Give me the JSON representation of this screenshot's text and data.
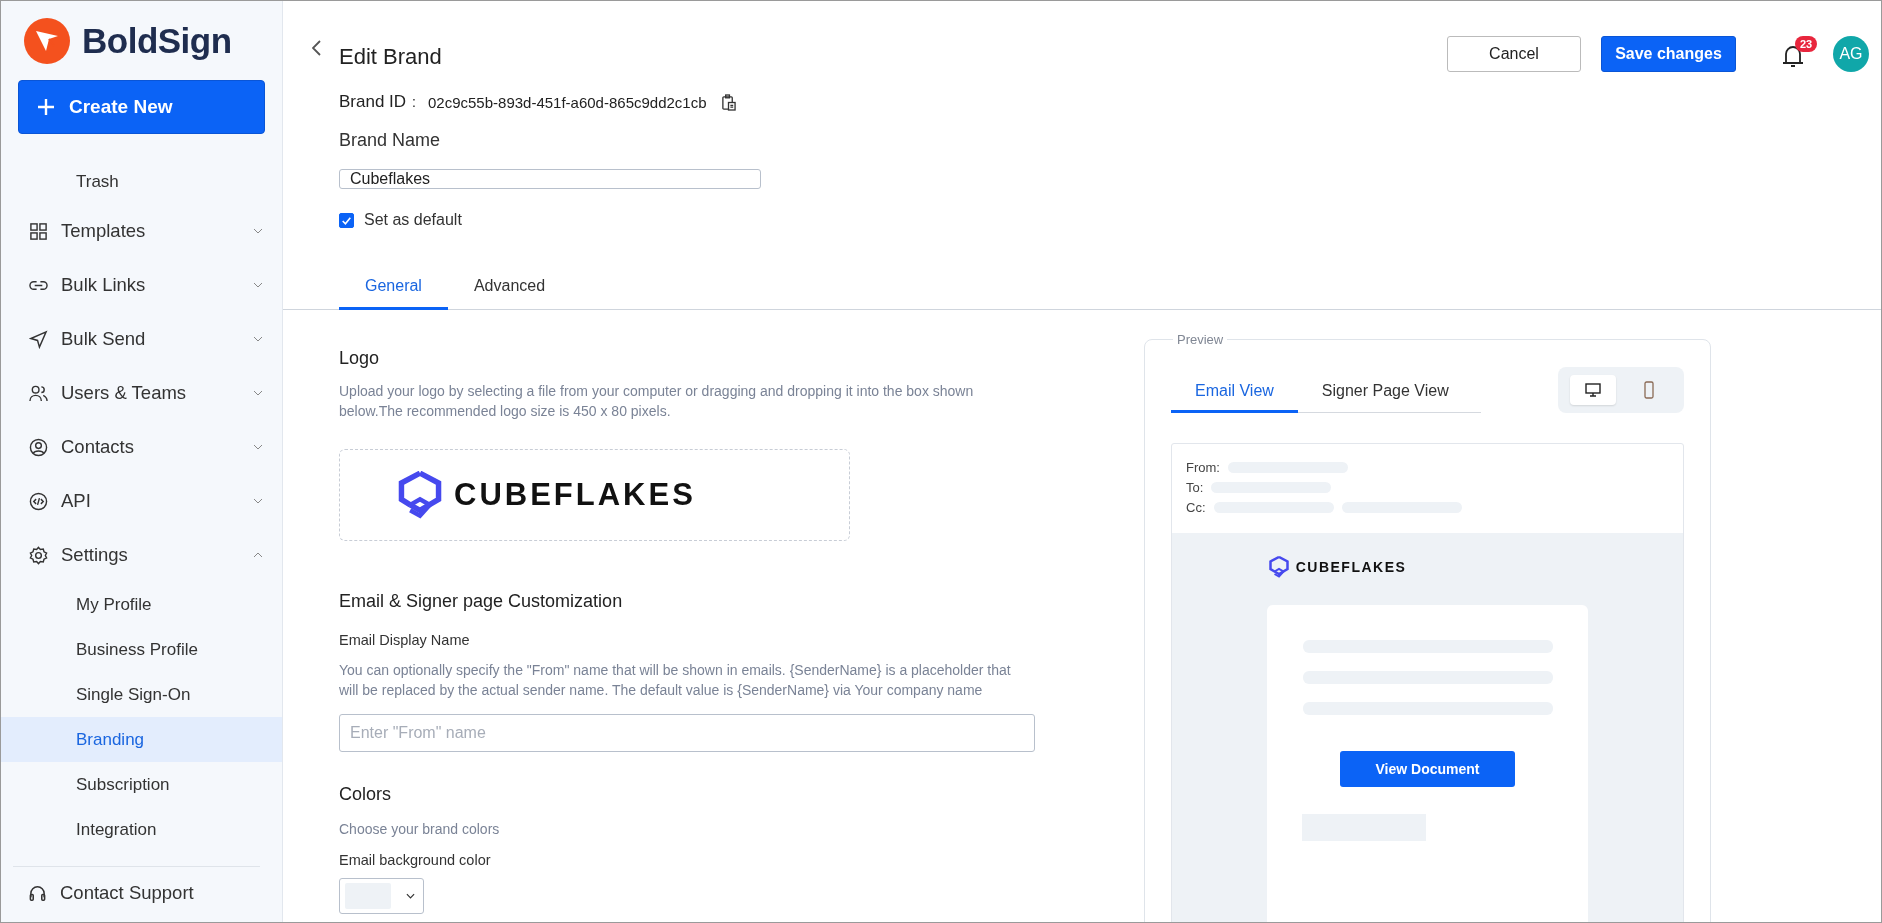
{
  "sidebar": {
    "brand": "BoldSign",
    "create_button": "Create New",
    "scrolled_items": [
      {
        "label": "Trash",
        "selected": false
      }
    ],
    "nav": [
      {
        "label": "Templates",
        "expanded": false
      },
      {
        "label": "Bulk Links",
        "expanded": false
      },
      {
        "label": "Bulk Send",
        "expanded": false
      },
      {
        "label": "Users & Teams",
        "expanded": false
      },
      {
        "label": "Contacts",
        "expanded": false
      },
      {
        "label": "API",
        "expanded": false
      },
      {
        "label": "Settings",
        "expanded": true,
        "children": [
          {
            "label": "My Profile",
            "selected": false
          },
          {
            "label": "Business Profile",
            "selected": false
          },
          {
            "label": "Single Sign-On",
            "selected": false
          },
          {
            "label": "Branding",
            "selected": true
          },
          {
            "label": "Subscription",
            "selected": false
          },
          {
            "label": "Integration",
            "selected": false
          }
        ]
      }
    ],
    "footer": "Contact Support"
  },
  "header": {
    "title": "Edit Brand",
    "cancel_button": "Cancel",
    "save_button": "Save changes",
    "notifications": "23",
    "avatar": "AG"
  },
  "brand_id": {
    "label": "Brand ID",
    "separator": ":",
    "value": "02c9c55b-893d-451f-a60d-865c9dd2c1cb"
  },
  "brand_name": {
    "label": "Brand Name",
    "value": "Cubeflakes"
  },
  "default_checkbox": {
    "label": "Set as default",
    "checked": true
  },
  "tabs": [
    {
      "label": "General",
      "selected": true
    },
    {
      "label": "Advanced",
      "selected": false
    }
  ],
  "logo": {
    "heading": "Logo",
    "description": "Upload your logo by selecting a file from your computer or dragging and dropping it into the box shown below.The recommended logo size is 450 x 80 pixels.",
    "logo_text": "CUBEFLAKES"
  },
  "customization": {
    "heading": "Email & Signer page Customization",
    "field_label": "Email Display Name",
    "description": "You can optionally specify the \"From\" name that will be shown in emails. {SenderName} is a placeholder that will be replaced by the actual sender name. The default value is {SenderName} via Your company name",
    "placeholder": "Enter \"From\" name"
  },
  "colors": {
    "heading": "Colors",
    "description": "Choose your brand colors",
    "field_label": "Email background color"
  },
  "preview": {
    "legend": "Preview",
    "tabs": [
      {
        "label": "Email View",
        "selected": true
      },
      {
        "label": "Signer Page View",
        "selected": false
      }
    ],
    "devices": [
      {
        "kind": "desktop",
        "selected": true
      },
      {
        "kind": "phone",
        "selected": false
      }
    ],
    "email_fields": [
      "From:",
      "To:",
      "Cc:"
    ],
    "logo_text": "CUBEFLAKES",
    "button": "View Document"
  }
}
